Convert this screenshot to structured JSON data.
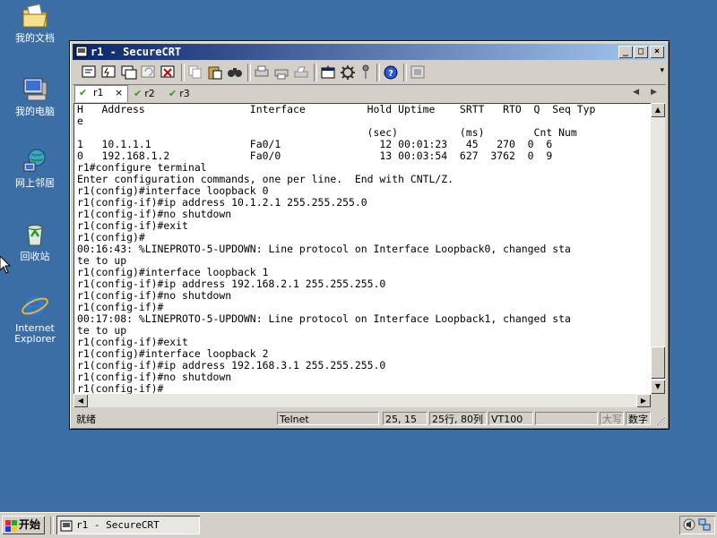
{
  "desktop": {
    "icons": [
      {
        "label": "我的文档"
      },
      {
        "label": "我的电脑"
      },
      {
        "label": "网上邻居"
      },
      {
        "label": "回收站"
      },
      {
        "label": "Internet",
        "label2": "Explorer"
      }
    ]
  },
  "window": {
    "title": "r1 - SecureCRT",
    "buttons": {
      "minimize": "_",
      "maximize": "□",
      "close": "×"
    },
    "tabs": [
      {
        "label": "r1",
        "active": true,
        "close": "×"
      },
      {
        "label": "r2",
        "active": false
      },
      {
        "label": "r3",
        "active": false
      }
    ],
    "terminal_lines": [
      "H   Address                 Interface          Hold Uptime    SRTT   RTO  Q  Seq Typ",
      "e",
      "                                               (sec)          (ms)        Cnt Num",
      "1   10.1.1.1                Fa0/1                12 00:01:23   45   270  0  6",
      "0   192.168.1.2             Fa0/0                13 00:03:54  627  3762  0  9",
      "r1#configure terminal",
      "Enter configuration commands, one per line.  End with CNTL/Z.",
      "r1(config)#interface loopback 0",
      "r1(config-if)#ip address 10.1.2.1 255.255.255.0",
      "r1(config-if)#no shutdown",
      "r1(config-if)#exit",
      "r1(config)#",
      "00:16:43: %LINEPROTO-5-UPDOWN: Line protocol on Interface Loopback0, changed sta",
      "te to up",
      "r1(config)#interface loopback 1",
      "r1(config-if)#ip address 192.168.2.1 255.255.255.0",
      "r1(config-if)#no shutdown",
      "r1(config-if)#",
      "00:17:08: %LINEPROTO-5-UPDOWN: Line protocol on Interface Loopback1, changed sta",
      "te to up",
      "r1(config-if)#exit",
      "r1(config)#interface loopback 2",
      "r1(config-if)#ip address 192.168.3.1 255.255.255.0",
      "r1(config-if)#no shutdown",
      "r1(config-if)#"
    ],
    "status": {
      "ready": "就绪",
      "protocol": "Telnet",
      "cursor": "25, 15",
      "size": "25行, 80列",
      "emulation": "VT100",
      "caps": "大写",
      "num": "数字"
    }
  },
  "taskbar": {
    "start_label": "开始",
    "task_label": "r1 - SecureCRT"
  }
}
